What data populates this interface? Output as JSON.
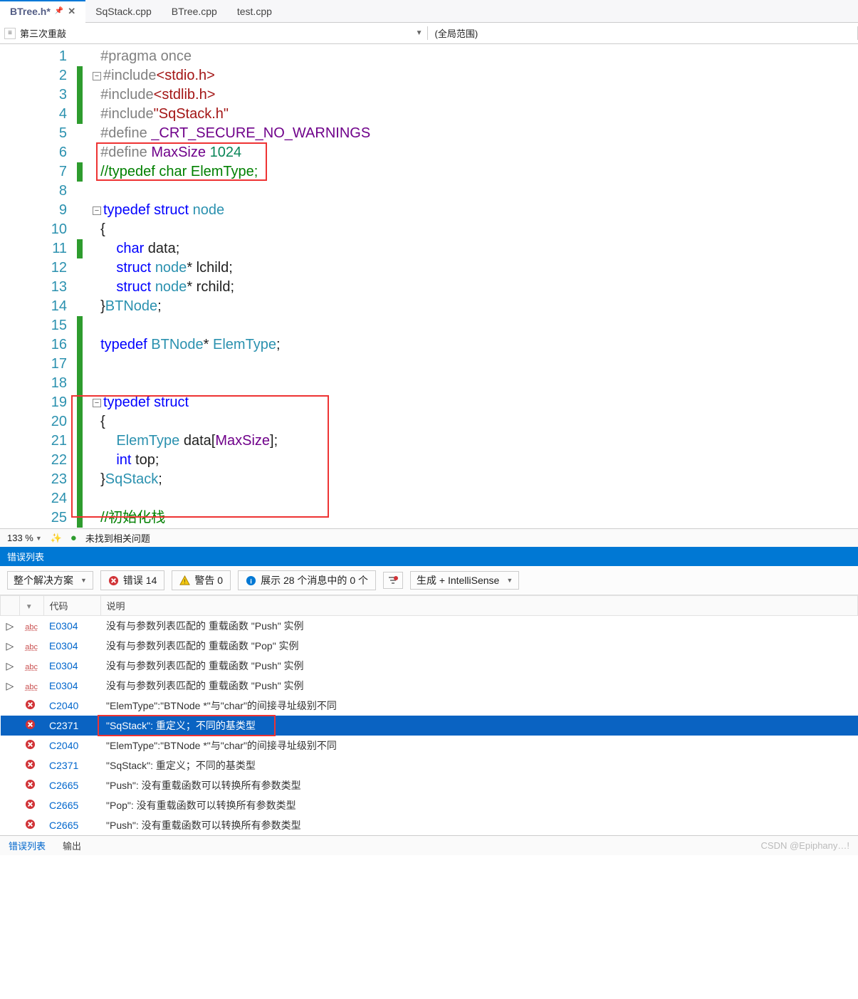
{
  "tabs": {
    "active": "BTree.h*",
    "others": [
      "SqStack.cpp",
      "BTree.cpp",
      "test.cpp"
    ]
  },
  "nav": {
    "left_icon": "method",
    "scope": "第三次重敲",
    "right": "(全局范围)"
  },
  "code": {
    "lines": [
      {
        "n": "1",
        "mark": "",
        "fold": "",
        "html": "<span class='k-pp'>#pragma</span> <span class='k-pp'>once</span>"
      },
      {
        "n": "2",
        "mark": "g",
        "fold": "-",
        "html": "<span class='k-pp'>#include</span><span class='k-inc'>&lt;stdio.h&gt;</span>"
      },
      {
        "n": "3",
        "mark": "g",
        "fold": "",
        "html": "<span class='k-pp'>#include</span><span class='k-inc'>&lt;stdlib.h&gt;</span>"
      },
      {
        "n": "4",
        "mark": "g",
        "fold": "",
        "html": "<span class='k-pp'>#include</span><span class='k-inc'>\"SqStack.h\"</span>"
      },
      {
        "n": "5",
        "mark": "",
        "fold": "",
        "html": "<span class='k-pp'>#define</span> <span class='k-macro'>_CRT_SECURE_NO_WARNINGS</span>"
      },
      {
        "n": "6",
        "mark": "",
        "fold": "",
        "html": "<span class='k-pp'>#define</span> <span class='k-macro'>MaxSize</span> <span class='k-num'>1024</span>"
      },
      {
        "n": "7",
        "mark": "g",
        "fold": "",
        "html": "<span class='k-cmt'>//typedef char ElemType;</span>"
      },
      {
        "n": "8",
        "mark": "",
        "fold": "",
        "html": ""
      },
      {
        "n": "9",
        "mark": "",
        "fold": "-",
        "html": "<span class='k-kw'>typedef</span> <span class='k-kw'>struct</span> <span class='k-type'>node</span>"
      },
      {
        "n": "10",
        "mark": "",
        "fold": "",
        "html": "{"
      },
      {
        "n": "11",
        "mark": "g",
        "fold": "",
        "html": "    <span class='k-kw'>char</span> data;"
      },
      {
        "n": "12",
        "mark": "",
        "fold": "",
        "html": "    <span class='k-kw'>struct</span> <span class='k-type'>node</span>* lchild;"
      },
      {
        "n": "13",
        "mark": "",
        "fold": "",
        "html": "    <span class='k-kw'>struct</span> <span class='k-type'>node</span>* rchild;"
      },
      {
        "n": "14",
        "mark": "",
        "fold": "",
        "html": "}<span class='k-type'>BTNode</span>;"
      },
      {
        "n": "15",
        "mark": "g",
        "fold": "",
        "html": ""
      },
      {
        "n": "16",
        "mark": "g",
        "fold": "",
        "html": "<span class='k-kw'>typedef</span> <span class='k-type'>BTNode</span>* <span class='k-type'>ElemType</span>;"
      },
      {
        "n": "17",
        "mark": "g",
        "fold": "",
        "html": ""
      },
      {
        "n": "18",
        "mark": "g",
        "fold": "",
        "html": ""
      },
      {
        "n": "19",
        "mark": "g",
        "fold": "-",
        "html": "<span class='k-kw'>typedef</span> <span class='k-kw'>struct</span>"
      },
      {
        "n": "20",
        "mark": "g",
        "fold": "",
        "html": "{"
      },
      {
        "n": "21",
        "mark": "g",
        "fold": "",
        "html": "    <span class='k-type'>ElemType</span> data[<span class='k-macro'>MaxSize</span>];"
      },
      {
        "n": "22",
        "mark": "g",
        "fold": "",
        "html": "    <span class='k-kw'>int</span> top;"
      },
      {
        "n": "23",
        "mark": "g",
        "fold": "",
        "html": "}<span class='k-type'>SqStack</span>;"
      },
      {
        "n": "24",
        "mark": "g",
        "fold": "",
        "html": ""
      },
      {
        "n": "25",
        "mark": "g",
        "fold": "",
        "html": "<span class='k-cmt'>//初始化栈</span>"
      }
    ]
  },
  "status": {
    "zoom": "133 %",
    "msg": "未找到相关问题"
  },
  "panel": {
    "title": "错误列表",
    "scope": "整个解决方案",
    "err": "错误 14",
    "warn": "警告 0",
    "info": "展示 28 个消息中的 0 个",
    "build": "生成 + IntelliSense",
    "cols": {
      "code": "代码",
      "desc": "说明"
    }
  },
  "errors": [
    {
      "sev": "abc",
      "code": "E0304",
      "desc": "没有与参数列表匹配的 重载函数 \"Push\" 实例",
      "exp": true
    },
    {
      "sev": "abc",
      "code": "E0304",
      "desc": "没有与参数列表匹配的 重载函数 \"Pop\" 实例",
      "exp": true
    },
    {
      "sev": "abc",
      "code": "E0304",
      "desc": "没有与参数列表匹配的 重载函数 \"Push\" 实例",
      "exp": true
    },
    {
      "sev": "abc",
      "code": "E0304",
      "desc": "没有与参数列表匹配的 重载函数 \"Push\" 实例",
      "exp": true
    },
    {
      "sev": "err",
      "code": "C2040",
      "desc": "\"ElemType\":\"BTNode *\"与\"char\"的间接寻址级别不同"
    },
    {
      "sev": "err",
      "code": "C2371",
      "desc": "\"SqStack\": 重定义；不同的基类型",
      "sel": true
    },
    {
      "sev": "err",
      "code": "C2040",
      "desc": "\"ElemType\":\"BTNode *\"与\"char\"的间接寻址级别不同"
    },
    {
      "sev": "err",
      "code": "C2371",
      "desc": "\"SqStack\": 重定义；不同的基类型"
    },
    {
      "sev": "err",
      "code": "C2665",
      "desc": "\"Push\": 没有重载函数可以转换所有参数类型"
    },
    {
      "sev": "err",
      "code": "C2665",
      "desc": "\"Pop\": 没有重载函数可以转换所有参数类型"
    },
    {
      "sev": "err",
      "code": "C2665",
      "desc": "\"Push\": 没有重载函数可以转换所有参数类型"
    }
  ],
  "bottom": {
    "active": "错误列表",
    "other": "输出"
  },
  "watermark": "CSDN @Epiphany…!"
}
